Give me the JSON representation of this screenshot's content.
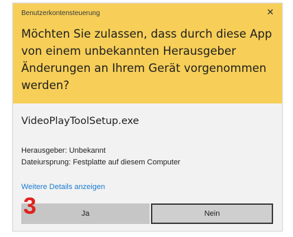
{
  "dialog": {
    "title": "Benutzerkontensteuerung",
    "close_glyph": "✕",
    "question": "Möchten Sie zulassen, dass durch diese App von einem unbekannten Herausgeber Änderungen an Ihrem Gerät vorgenommen werden?",
    "program_name": "VideoPlayToolSetup.exe",
    "publisher": "Herausgeber: Unbekannt",
    "file_origin": "Dateiursprung: Festplatte auf diesem Computer",
    "details_link": "Weitere Details anzeigen",
    "yes_label": "Ja",
    "no_label": "Nein"
  },
  "annotation": {
    "step_number": "3"
  },
  "colors": {
    "header_background": "#f7cf58",
    "body_background": "#f2f2f2",
    "link": "#1a7cd0",
    "step_marker": "#e0201c"
  },
  "icons": {
    "close": "close-icon"
  }
}
